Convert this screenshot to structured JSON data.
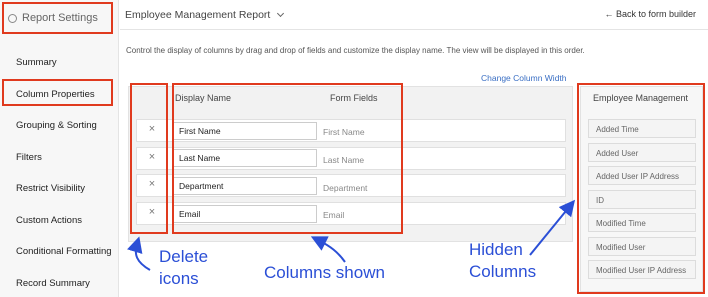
{
  "sidebar": {
    "header": "Report Settings",
    "items": [
      {
        "label": "Summary"
      },
      {
        "label": "Column Properties"
      },
      {
        "label": "Grouping & Sorting"
      },
      {
        "label": "Filters"
      },
      {
        "label": "Restrict Visibility"
      },
      {
        "label": "Custom Actions"
      },
      {
        "label": "Conditional Formatting"
      },
      {
        "label": "Record Summary"
      }
    ],
    "active_index": 1
  },
  "topbar": {
    "report_title": "Employee Management Report",
    "back_link": "← Back to form builder"
  },
  "main": {
    "info_text": "Control the display of columns by drag and drop of fields and customize the display name. The view will be displayed in this order.",
    "change_width_link": "Change Column Width",
    "table": {
      "headers": {
        "display_name": "Display Name",
        "form_fields": "Form Fields"
      },
      "rows": [
        {
          "display_name": "First Name",
          "form_field": "First Name",
          "delete": "×"
        },
        {
          "display_name": "Last Name",
          "form_field": "Last Name",
          "delete": "×"
        },
        {
          "display_name": "Department",
          "form_field": "Department",
          "delete": "×"
        },
        {
          "display_name": "Email",
          "form_field": "Email",
          "delete": "×"
        }
      ]
    }
  },
  "hidden_columns": {
    "title": "Employee Management",
    "items": [
      "Added Time",
      "Added User",
      "Added User IP Address",
      "ID",
      "Modified Time",
      "Modified User",
      "Modified User IP Address"
    ]
  },
  "annotations": {
    "delete_icons": "Delete\nicons",
    "columns_shown": "Columns shown",
    "hidden_columns": "Hidden\nColumns"
  },
  "colors": {
    "annotation_box": "#e03a1e",
    "annotation_text": "#2b4fd6",
    "link": "#3a6fc4"
  }
}
